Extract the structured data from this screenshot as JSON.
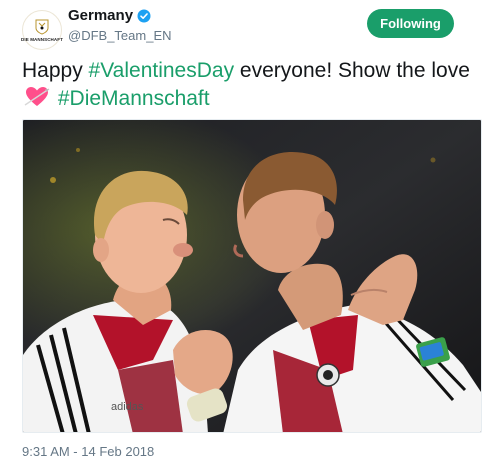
{
  "account": {
    "display_name": "Germany",
    "handle": "@DFB_Team_EN",
    "avatar_text": "DIE MANNSCHAFT",
    "verified": true
  },
  "follow_button": {
    "label": "Following"
  },
  "tweet": {
    "text_parts": {
      "p1": "Happy ",
      "tag1": "#ValentinesDay",
      "p2": " everyone! Show the love ",
      "tag2": "#DieMannschaft"
    },
    "heart_emoji": "heart-with-arrow-icon"
  },
  "media": {
    "description_icon": "photo",
    "kit_brand": "adidas"
  },
  "timestamp": "9:31 AM - 14 Feb 2018",
  "colors": {
    "accent": "#1a9e6a",
    "text": "#14171a",
    "muted": "#657786",
    "verified": "#1da1f2"
  }
}
